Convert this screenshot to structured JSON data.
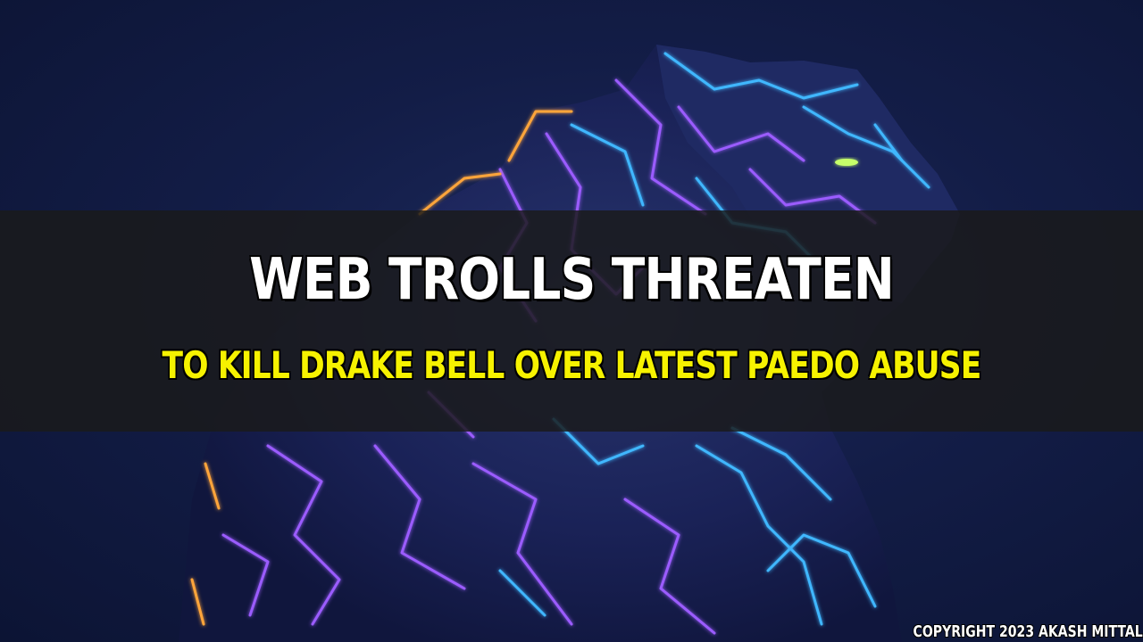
{
  "headline": {
    "line1": "WEB TROLLS THREATEN",
    "line2": "TO KILL DRAKE BELL OVER LATEST PAEDO ABUSE"
  },
  "footer": {
    "copyright": "COPYRIGHT 2023 AKASH MITTAL"
  },
  "colors": {
    "background": "#131d47",
    "band": "#1a1a1a",
    "headline_primary": "#ffffff",
    "headline_secondary": "#f6f200",
    "neon_violet": "#9b5cff",
    "neon_cyan": "#3fb7ff",
    "neon_orange": "#ffa53a"
  },
  "image": {
    "subject": "neon-panther-illustration"
  }
}
